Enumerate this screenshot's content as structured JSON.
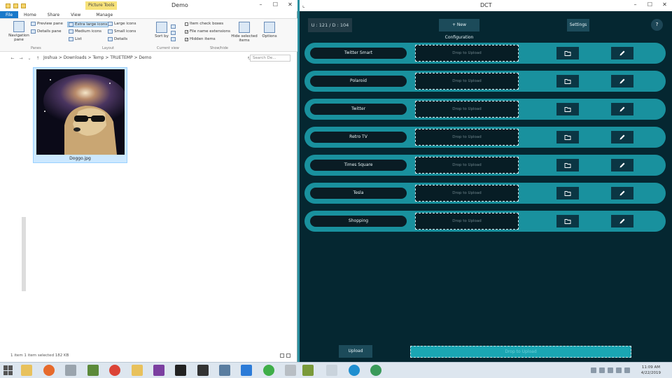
{
  "explorer": {
    "title": "Demo",
    "picture_tools": "Picture Tools",
    "tabs": [
      "File",
      "Home",
      "Share",
      "View",
      "Manage"
    ],
    "ribbon": {
      "navigation_pane": "Navigation pane",
      "preview_pane": "Preview pane",
      "details_pane": "Details pane",
      "panes_group": "Panes",
      "extra_large_icons": "Extra large icons",
      "large_icons": "Large icons",
      "medium_icons": "Medium icons",
      "small_icons": "Small icons",
      "list": "List",
      "details": "Details",
      "layout_group": "Layout",
      "sort_by": "Sort by",
      "current_view_group": "Current view",
      "item_check_boxes": "Item check boxes",
      "file_name_extensions": "File name extensions",
      "hidden_items": "Hidden items",
      "hide_selected": "Hide selected items",
      "options": "Options",
      "show_hide_group": "Show/hide"
    },
    "address": {
      "crumbs": "Joshua  >  Downloads  >  Temp  >  TRUETEMP  >  Demo",
      "search_placeholder": "Search De..."
    },
    "file": {
      "name": "Doggo.jpg"
    },
    "status": "1 item    1 item selected  182 KB"
  },
  "dct": {
    "title": "DCT",
    "counter": "U : 121 / D : 104",
    "new_config": "+ New Configuration",
    "settings": "Settings",
    "help": "?",
    "drop_label": "Drop to Upload",
    "rows": [
      {
        "name": "Twitter Smart"
      },
      {
        "name": "Polaroid"
      },
      {
        "name": "Twitter"
      },
      {
        "name": "Retro TV"
      },
      {
        "name": "Times Square"
      },
      {
        "name": "Tesla"
      },
      {
        "name": "Shopping"
      }
    ],
    "upload": "Upload",
    "bottom_drop": "Drop to Upload"
  },
  "taskbar": {
    "time": "11:09 AM",
    "date": "4/22/2019"
  },
  "colors": {
    "dct_bg": "#052731",
    "row_teal": "#19919e",
    "button_dark": "#0b3644",
    "explorer_file_tab": "#1979ca"
  }
}
